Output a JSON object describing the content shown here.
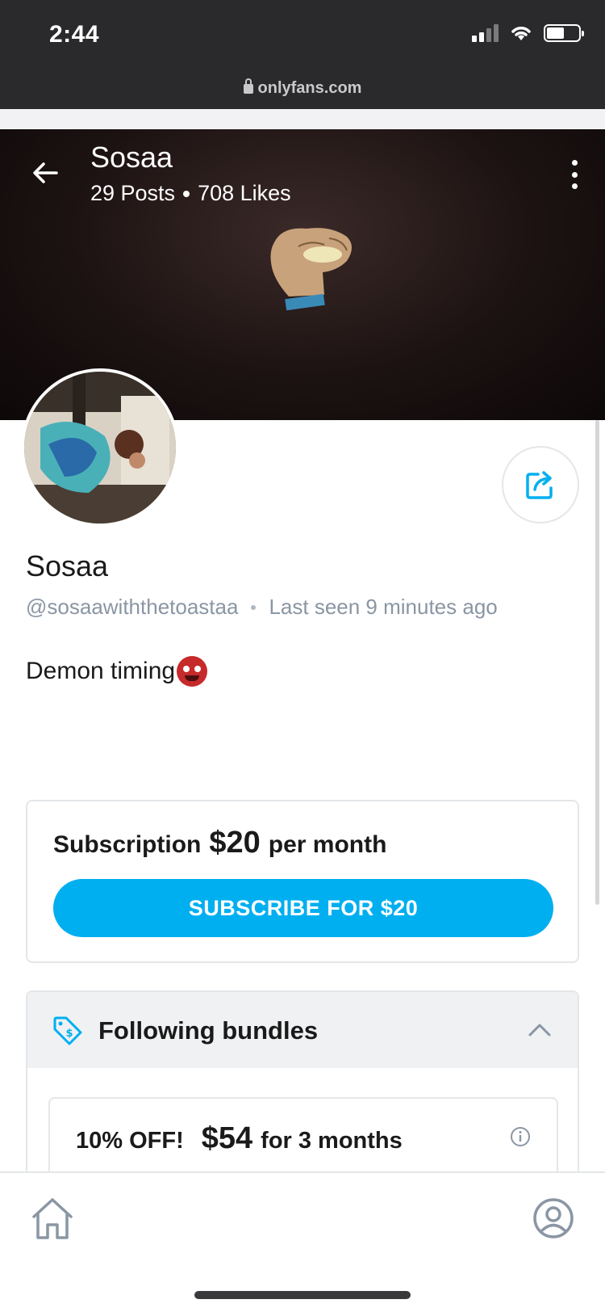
{
  "status_bar": {
    "time": "2:44",
    "url": "onlyfans.com",
    "icons": [
      "signal-icon",
      "wifi-icon",
      "battery-icon",
      "lock-icon"
    ]
  },
  "header": {
    "name": "Sosaa",
    "posts": "29 Posts",
    "likes": "708 Likes"
  },
  "profile": {
    "name": "Sosaa",
    "handle": "@sosaawiththetoastaa",
    "last_seen": "Last seen 9 minutes ago",
    "bio": "Demon timing"
  },
  "subscription": {
    "label": "Subscription",
    "price": "$20",
    "period": "per month",
    "button_label": "SUBSCRIBE FOR $20"
  },
  "bundles": {
    "title": "Following bundles",
    "items": [
      {
        "discount": "10% OFF!",
        "price": "$54",
        "duration": "for 3 months"
      }
    ]
  },
  "colors": {
    "accent": "#00aff0",
    "muted_text": "#8a96a3",
    "status_bar_bg": "#2a2a2c"
  }
}
